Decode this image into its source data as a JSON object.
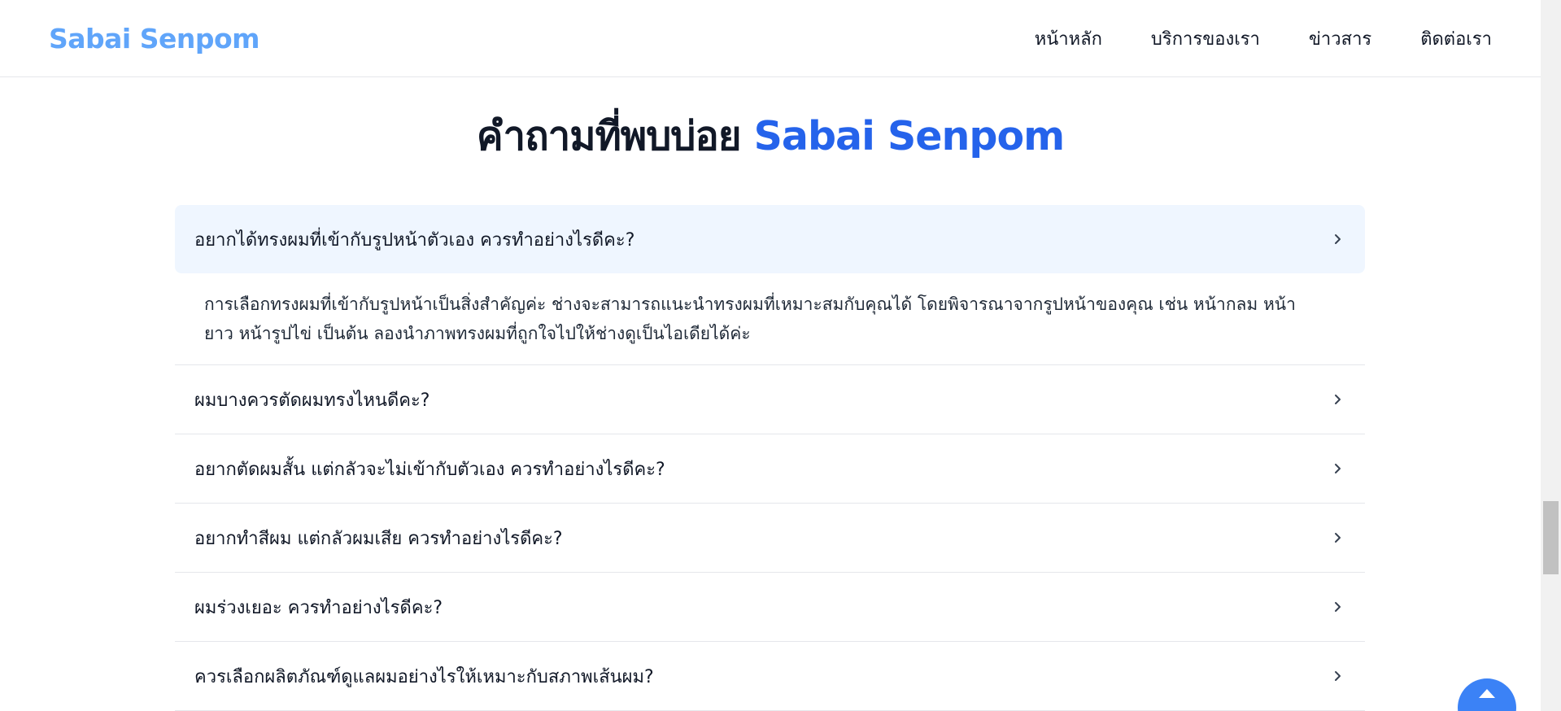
{
  "navbar": {
    "brand": "Sabai Senpom",
    "links": [
      "หน้าหลัก",
      "บริการของเรา",
      "ข่าวสาร",
      "ติดต่อเรา"
    ]
  },
  "faq": {
    "title_prefix": "คำถามที่พบบ่อย",
    "title_accent": "Sabai Senpom",
    "items": [
      {
        "question": "อยากได้ทรงผมที่เข้ากับรูปหน้าตัวเอง ควรทำอย่างไรดีคะ?",
        "answer_line1": "การเลือกทรงผมที่เข้ากับรูปหน้าเป็นสิ่งสำคัญค่ะ ช่างจะสามารถแนะนำทรงผมที่เหมาะสมกับคุณได้ โดยพิจารณาจากรูปหน้าของคุณ เช่น หน้ากลม หน้า",
        "answer_line2": "ยาว หน้ารูปไข่ เป็นต้น ลองนำภาพทรงผมที่ถูกใจไปให้ช่างดูเป็นไอเดียได้ค่ะ"
      },
      {
        "question": "ผมบางควรตัดผมทรงไหนดีคะ?"
      },
      {
        "question": "อยากตัดผมสั้น แต่กลัวจะไม่เข้ากับตัวเอง ควรทำอย่างไรดีคะ?"
      },
      {
        "question": "อยากทำสีผม แต่กลัวผมเสีย ควรทำอย่างไรดีคะ?"
      },
      {
        "question": "ผมร่วงเยอะ ควรทำอย่างไรดีคะ?"
      },
      {
        "question": "ควรเลือกผลิตภัณฑ์ดูแลผมอย่างไรให้เหมาะกับสภาพเส้นผม?"
      }
    ]
  },
  "colors": {
    "brand": "#60a5fa",
    "accent": "#2563eb",
    "open_item_bg": "#eff6ff"
  },
  "icons": {
    "chevron": "chevron-right-icon",
    "back_to_top": "arrow-up-icon"
  }
}
